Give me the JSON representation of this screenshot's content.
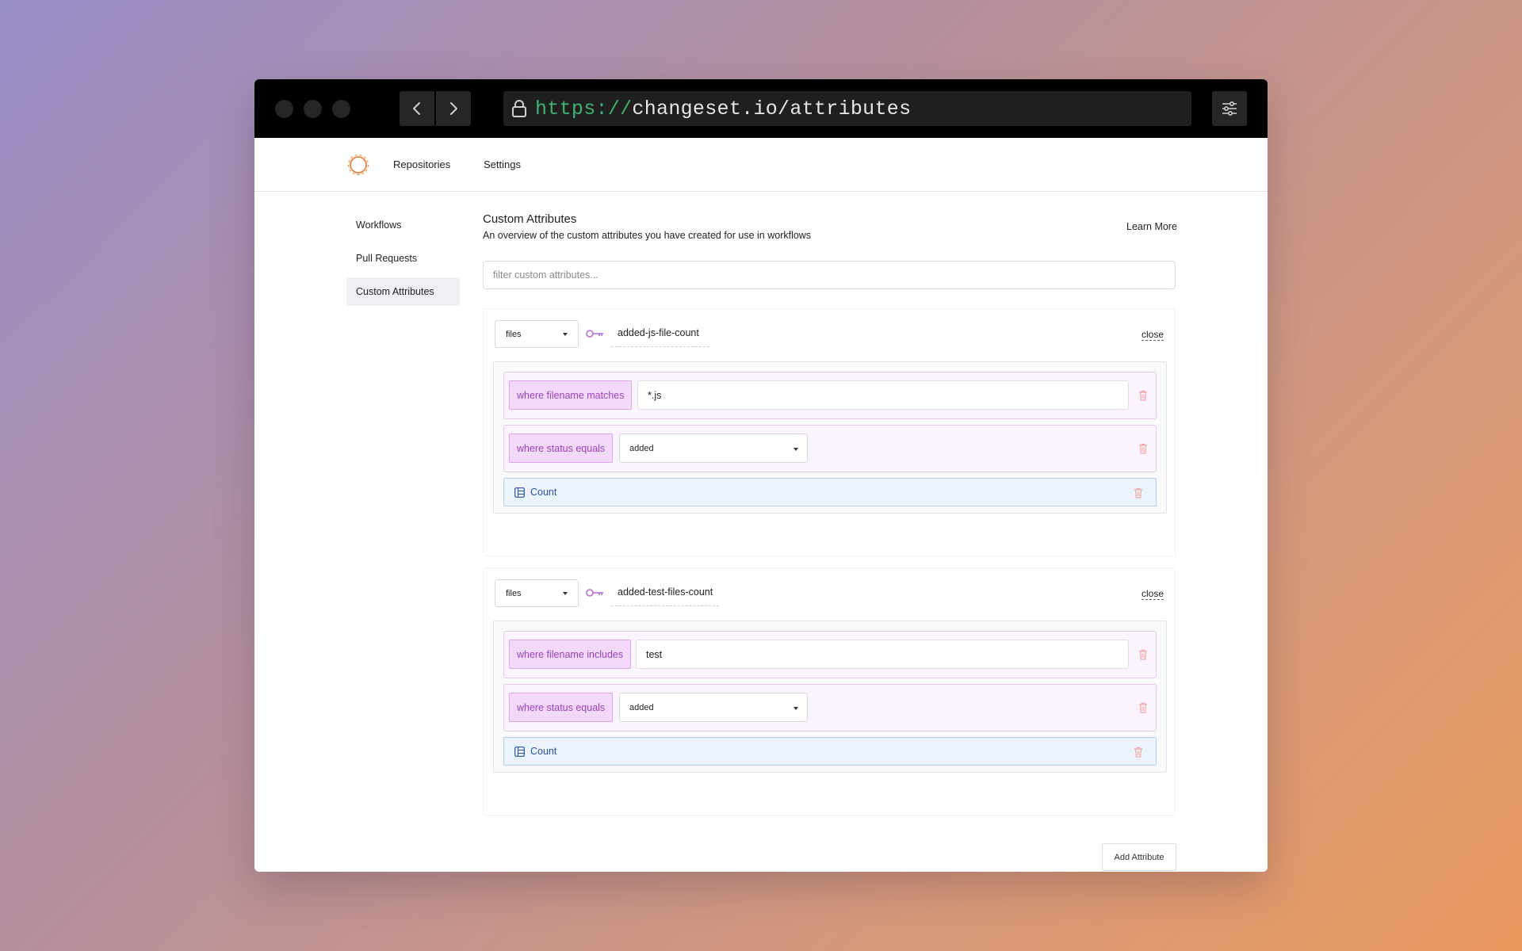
{
  "browser": {
    "url_protocol": "https://",
    "url_rest": "changeset.io/attributes"
  },
  "topnav": {
    "links": [
      "Repositories",
      "Settings"
    ]
  },
  "sidebar": {
    "items": [
      {
        "label": "Workflows",
        "active": false
      },
      {
        "label": "Pull Requests",
        "active": false
      },
      {
        "label": "Custom Attributes",
        "active": true
      }
    ]
  },
  "header": {
    "title": "Custom Attributes",
    "subtitle": "An overview of the custom attributes you have created for use in workflows",
    "learn_more": "Learn More"
  },
  "filter": {
    "placeholder": "filter custom attributes...",
    "value": ""
  },
  "attributes": [
    {
      "type": "files",
      "name": "added-js-file-count",
      "close_label": "close",
      "rules": [
        {
          "label": "where filename matches",
          "kind": "input",
          "value": "*.js"
        },
        {
          "label": "where status equals",
          "kind": "select",
          "value": "added"
        }
      ],
      "aggregate": "Count"
    },
    {
      "type": "files",
      "name": "added-test-files-count",
      "close_label": "close",
      "rules": [
        {
          "label": "where filename includes",
          "kind": "input",
          "value": "test"
        },
        {
          "label": "where status equals",
          "kind": "select",
          "value": "added"
        }
      ],
      "aggregate": "Count"
    }
  ],
  "actions": {
    "add_attribute": "Add Attribute"
  },
  "colors": {
    "logo": "#e9813a",
    "url_protocol": "#3cb371",
    "rule_accent": "#9b3fbf",
    "count_accent": "#2a4fa3",
    "trash": "#f3a8a8"
  },
  "icons": [
    "lock-icon",
    "chevron-left-icon",
    "chevron-right-icon",
    "sliders-icon",
    "logo-icon",
    "key-icon",
    "trash-icon",
    "table-icon"
  ]
}
